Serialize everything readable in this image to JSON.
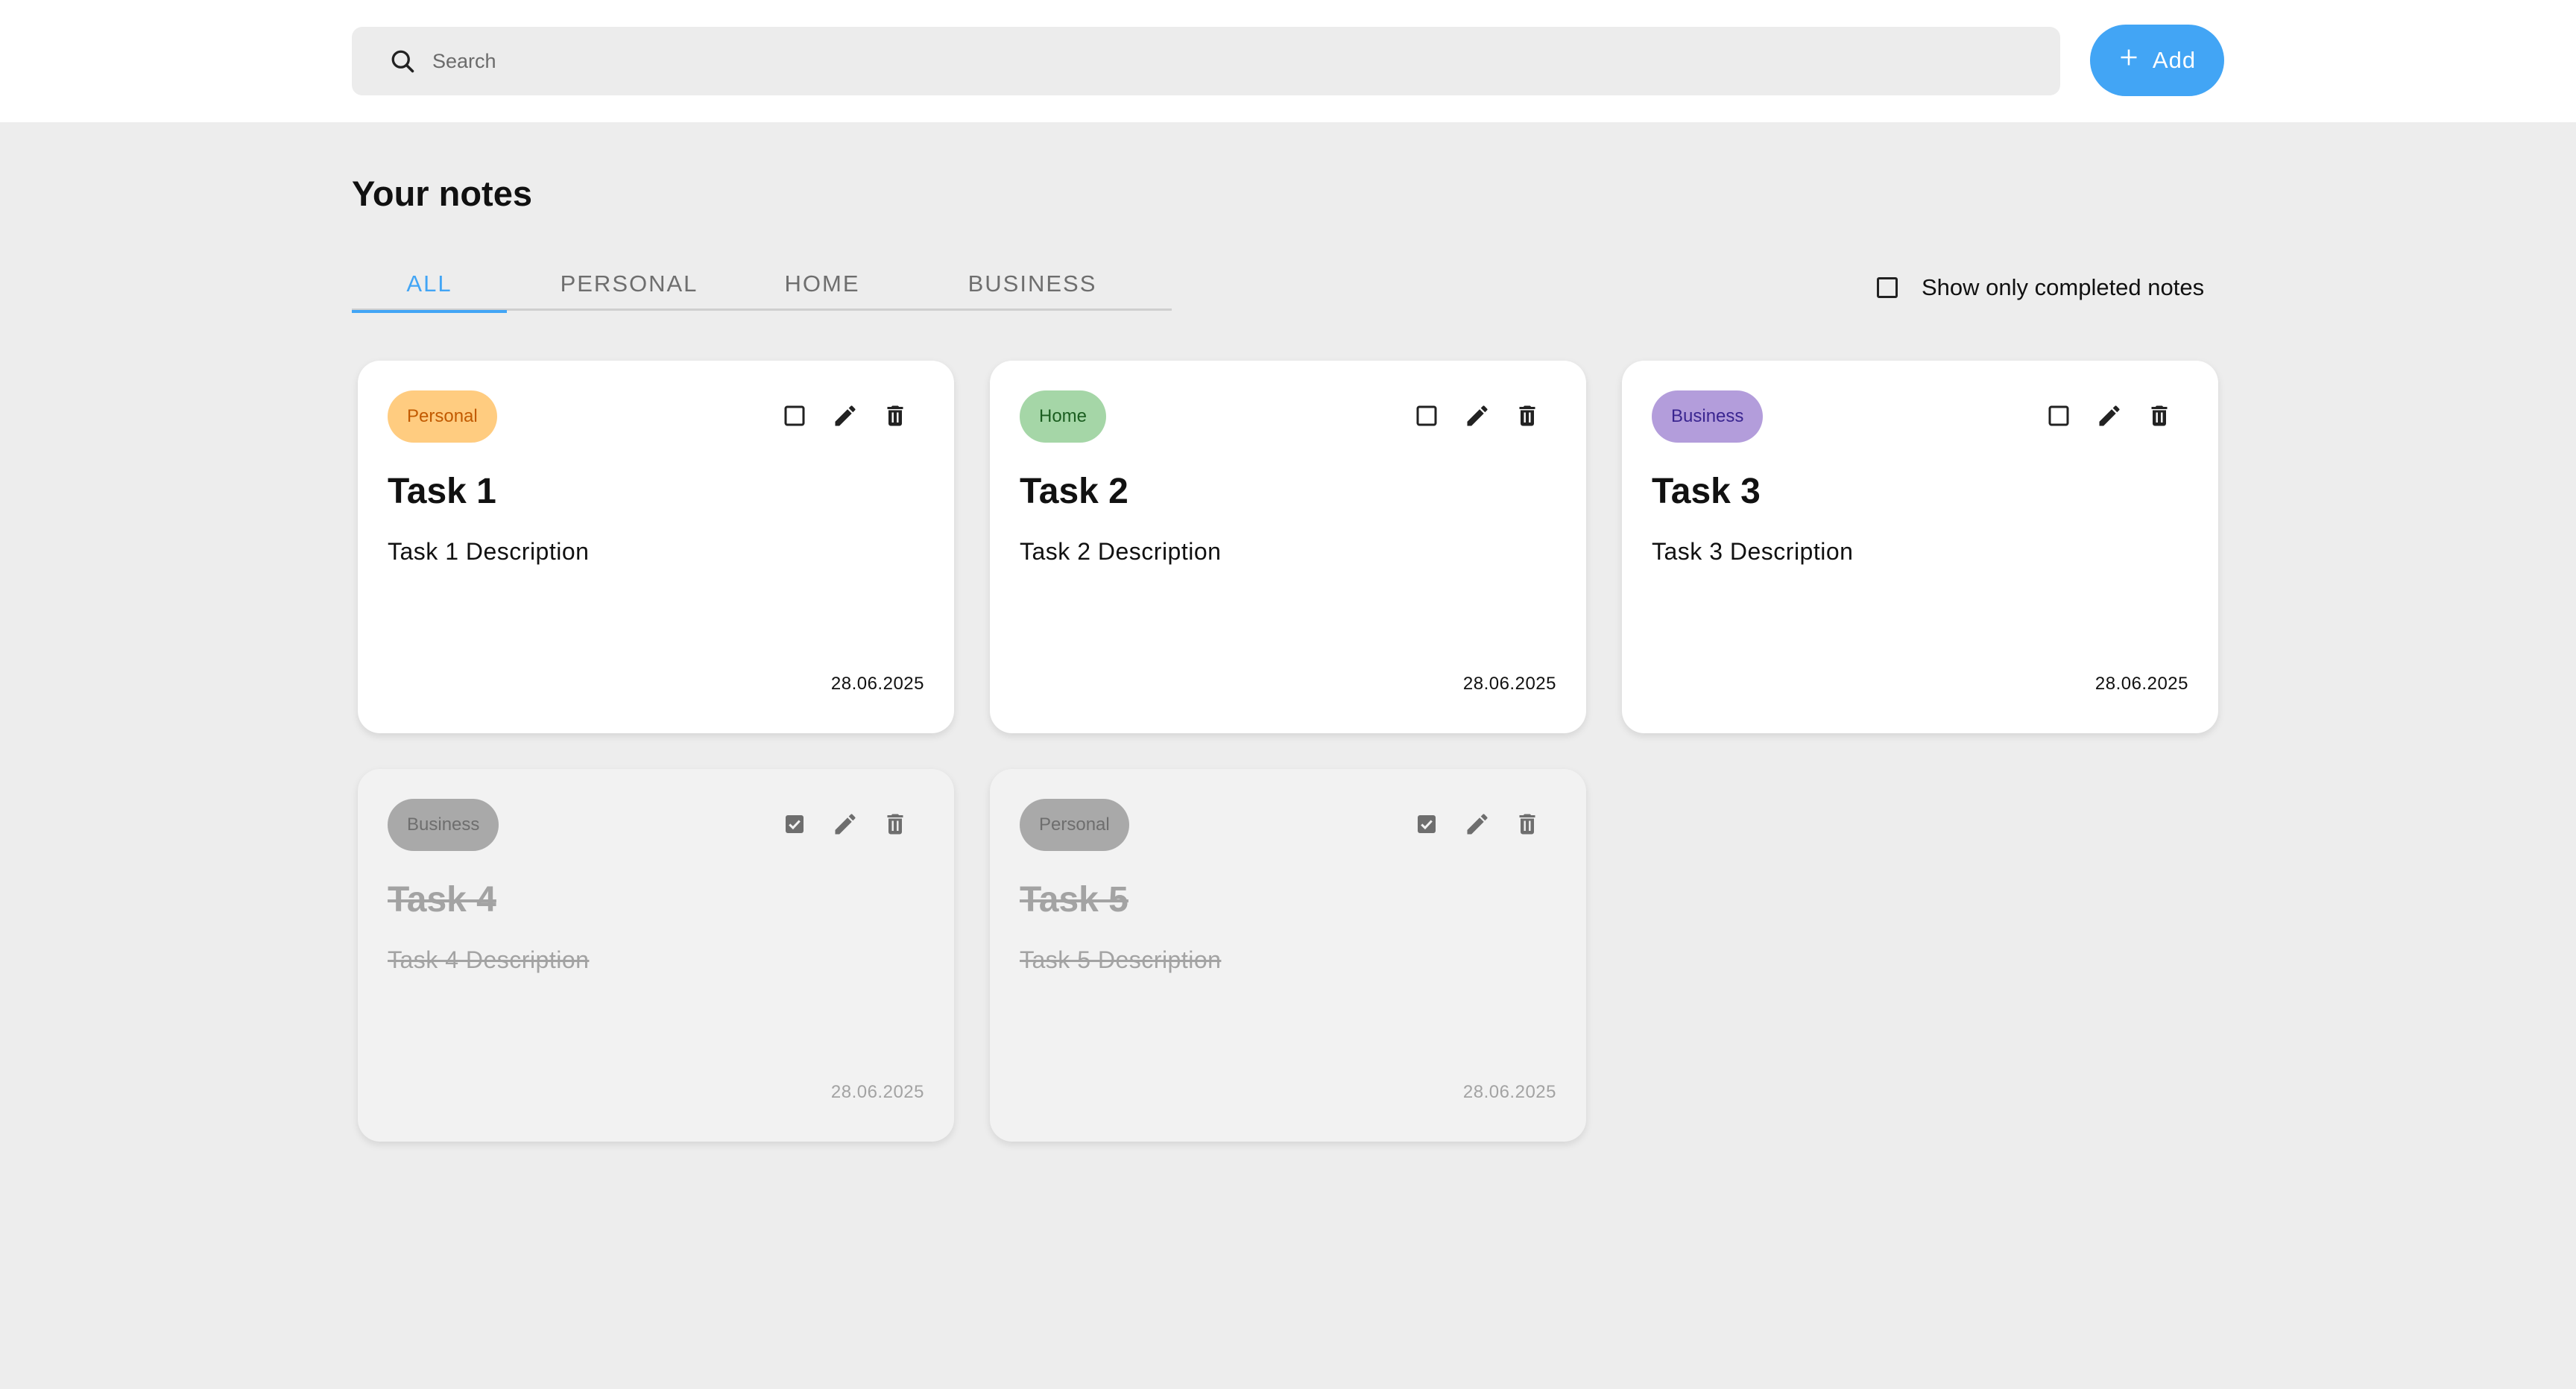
{
  "search": {
    "placeholder": "Search"
  },
  "add_button": {
    "label": "Add"
  },
  "page_title": "Your notes",
  "tabs": [
    {
      "label": "ALL",
      "active": true
    },
    {
      "label": "PERSONAL",
      "active": false
    },
    {
      "label": "HOME",
      "active": false
    },
    {
      "label": "BUSINESS",
      "active": false
    }
  ],
  "filter": {
    "label": "Show only completed notes",
    "checked": false
  },
  "colors": {
    "accent": "#42a5f5",
    "personal_badge": "#ffcc80",
    "home_badge": "#a5d6a7",
    "business_badge": "#b39ddb",
    "completed_badge": "#a9a9a9"
  },
  "notes": [
    {
      "category": "Personal",
      "title": "Task 1",
      "description": "Task 1 Description",
      "date": "28.06.2025",
      "completed": false
    },
    {
      "category": "Home",
      "title": "Task 2",
      "description": "Task 2 Description",
      "date": "28.06.2025",
      "completed": false
    },
    {
      "category": "Business",
      "title": "Task 3",
      "description": "Task 3 Description",
      "date": "28.06.2025",
      "completed": false
    },
    {
      "category": "Business",
      "title": "Task 4",
      "description": "Task 4 Description",
      "date": "28.06.2025",
      "completed": true
    },
    {
      "category": "Personal",
      "title": "Task 5",
      "description": "Task 5 Description",
      "date": "28.06.2025",
      "completed": true
    }
  ],
  "icons": {
    "search": "search-icon",
    "add": "plus-icon",
    "checkbox_empty": "checkbox-empty-icon",
    "checkbox_checked": "checkbox-checked-icon",
    "edit": "pencil-icon",
    "delete": "trash-icon"
  }
}
